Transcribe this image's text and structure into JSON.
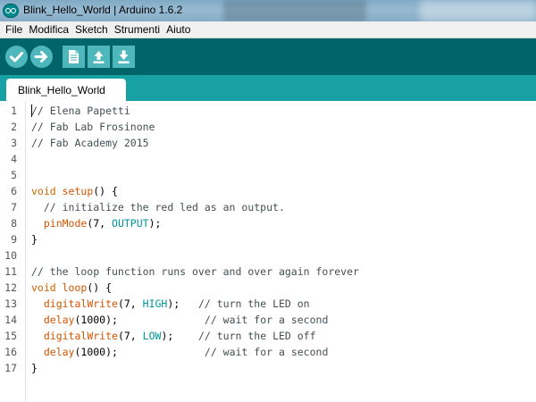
{
  "window": {
    "title": "Blink_Hello_World | Arduino 1.6.2",
    "icon": "arduino-logo-icon"
  },
  "menu": {
    "items": [
      "File",
      "Modifica",
      "Sketch",
      "Strumenti",
      "Aiuto"
    ]
  },
  "toolbar": {
    "buttons": [
      {
        "name": "verify-button",
        "icon": "checkmark-icon"
      },
      {
        "name": "upload-button",
        "icon": "arrow-right-icon"
      },
      {
        "name": "new-button",
        "icon": "new-file-icon"
      },
      {
        "name": "open-button",
        "icon": "arrow-up-icon"
      },
      {
        "name": "save-button",
        "icon": "arrow-down-icon"
      }
    ]
  },
  "tabs": [
    {
      "label": "Blink_Hello_World",
      "active": true
    }
  ],
  "colors": {
    "toolbar_bg": "#006468",
    "tabstrip_bg": "#17a1a5",
    "button_bg": "#4db7bb",
    "keyword": "#cc6600",
    "function": "#d35400",
    "constant": "#00979c",
    "comment": "#434f54"
  },
  "editor": {
    "lines": [
      [
        {
          "t": "// Elena Papetti",
          "c": "comment"
        }
      ],
      [
        {
          "t": "// Fab Lab Frosinone",
          "c": "comment"
        }
      ],
      [
        {
          "t": "// Fab Academy 2015",
          "c": "comment"
        }
      ],
      [],
      [],
      [
        {
          "t": "void ",
          "c": "type"
        },
        {
          "t": "setup",
          "c": "func"
        },
        {
          "t": "() {",
          "c": "plain"
        }
      ],
      [
        {
          "t": "  // initialize the red led as an output.",
          "c": "comment"
        }
      ],
      [
        {
          "t": "  ",
          "c": "plain"
        },
        {
          "t": "pinMode",
          "c": "func"
        },
        {
          "t": "(7, ",
          "c": "plain"
        },
        {
          "t": "OUTPUT",
          "c": "const"
        },
        {
          "t": ");",
          "c": "plain"
        }
      ],
      [
        {
          "t": "}",
          "c": "plain"
        }
      ],
      [],
      [
        {
          "t": "// the loop function runs over and over again forever",
          "c": "comment"
        }
      ],
      [
        {
          "t": "void ",
          "c": "type"
        },
        {
          "t": "loop",
          "c": "func"
        },
        {
          "t": "() {",
          "c": "plain"
        }
      ],
      [
        {
          "t": "  ",
          "c": "plain"
        },
        {
          "t": "digitalWrite",
          "c": "func"
        },
        {
          "t": "(7, ",
          "c": "plain"
        },
        {
          "t": "HIGH",
          "c": "const"
        },
        {
          "t": ");   ",
          "c": "plain"
        },
        {
          "t": "// turn the LED on",
          "c": "comment"
        }
      ],
      [
        {
          "t": "  ",
          "c": "plain"
        },
        {
          "t": "delay",
          "c": "func"
        },
        {
          "t": "(1000);              ",
          "c": "plain"
        },
        {
          "t": "// wait for a second",
          "c": "comment"
        }
      ],
      [
        {
          "t": "  ",
          "c": "plain"
        },
        {
          "t": "digitalWrite",
          "c": "func"
        },
        {
          "t": "(7, ",
          "c": "plain"
        },
        {
          "t": "LOW",
          "c": "const"
        },
        {
          "t": ");    ",
          "c": "plain"
        },
        {
          "t": "// turn the LED off",
          "c": "comment"
        }
      ],
      [
        {
          "t": "  ",
          "c": "plain"
        },
        {
          "t": "delay",
          "c": "func"
        },
        {
          "t": "(1000);              ",
          "c": "plain"
        },
        {
          "t": "// wait for a second",
          "c": "comment"
        }
      ],
      [
        {
          "t": "}",
          "c": "plain"
        }
      ]
    ]
  }
}
